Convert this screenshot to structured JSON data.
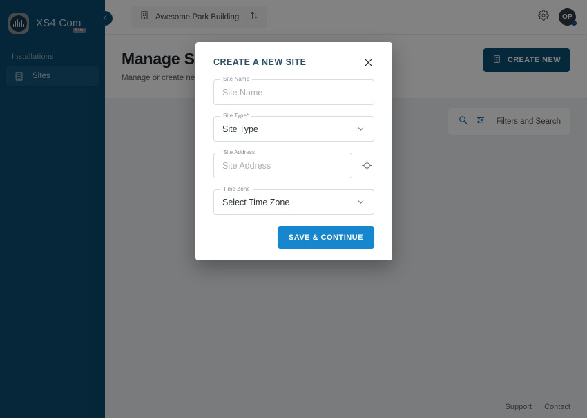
{
  "brand": {
    "name": "XS4 Com",
    "badge": "Beta",
    "logo_icon": "soundwave-icon"
  },
  "sidebar": {
    "section_label": "Installations",
    "items": [
      {
        "label": "Sites",
        "icon": "building-icon",
        "active": true
      }
    ],
    "collapse_icon": "chevron-left-icon",
    "bg_color": "#0b4c70",
    "active_bg_color": "#14567a"
  },
  "topbar": {
    "breadcrumb": {
      "icon": "building-icon",
      "label": "Awesome Park Building",
      "swap_icon": "arrows-up-down-icon"
    },
    "settings_icon": "gear-icon",
    "avatar": {
      "initials": "OP",
      "status_color": "#1c4fd8"
    }
  },
  "page": {
    "title": "Manage Sites",
    "subtitle": "Manage or create new sites",
    "create_button": {
      "label": "CREATE NEW",
      "icon": "building-icon",
      "color": "#0b5272"
    },
    "filters": {
      "search_icon": "search-icon",
      "filter_icon": "sliders-icon",
      "label": "Filters and Search"
    },
    "footer": {
      "support": "Support",
      "contact": "Contact"
    }
  },
  "modal": {
    "title": "CREATE A NEW SITE",
    "close_icon": "close-icon",
    "fields": [
      {
        "id": "site-name",
        "legend": "Site Name",
        "value": "Site Name",
        "is_placeholder": true,
        "control": "text"
      },
      {
        "id": "site-type",
        "legend": "Site Type*",
        "value": "Site Type",
        "is_placeholder": false,
        "control": "select",
        "chevron_icon": "chevron-down-icon"
      },
      {
        "id": "site-address",
        "legend": "Site Address",
        "value": "Site Address",
        "is_placeholder": true,
        "control": "text-with-gps",
        "gps_icon": "gps-crosshair-icon"
      },
      {
        "id": "time-zone",
        "legend": "Time Zone",
        "value": "Select Time Zone",
        "is_placeholder": false,
        "control": "select",
        "chevron_icon": "chevron-down-icon"
      }
    ],
    "submit": {
      "label": "SAVE & CONTINUE",
      "color": "#1687ce"
    }
  }
}
